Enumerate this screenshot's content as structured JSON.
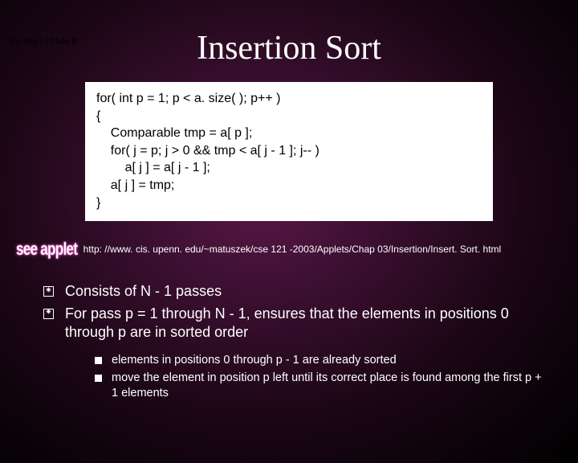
{
  "header": "Sorting I  / Slide 8",
  "title": "Insertion Sort",
  "code": "for( int p = 1; p < a. size( ); p++ )\n{\n    Comparable tmp = a[ p ];\n    for( j = p; j > 0 && tmp < a[ j - 1 ]; j-- )\n        a[ j ] = a[ j - 1 ];\n    a[ j ] = tmp;\n}",
  "see_applet": "see applet",
  "url": "http: //www. cis. upenn. edu/~matuszek/cse 121 -2003/Applets/Chap 03/Insertion/Insert. Sort. html",
  "bullets": [
    "Consists of N - 1 passes",
    "For pass p = 1 through N - 1, ensures that the elements in positions 0 through p are in sorted order"
  ],
  "subbullets": [
    "elements in positions 0 through p - 1 are already sorted",
    "move the element in position p left until its correct place is found among the first p + 1 elements"
  ]
}
